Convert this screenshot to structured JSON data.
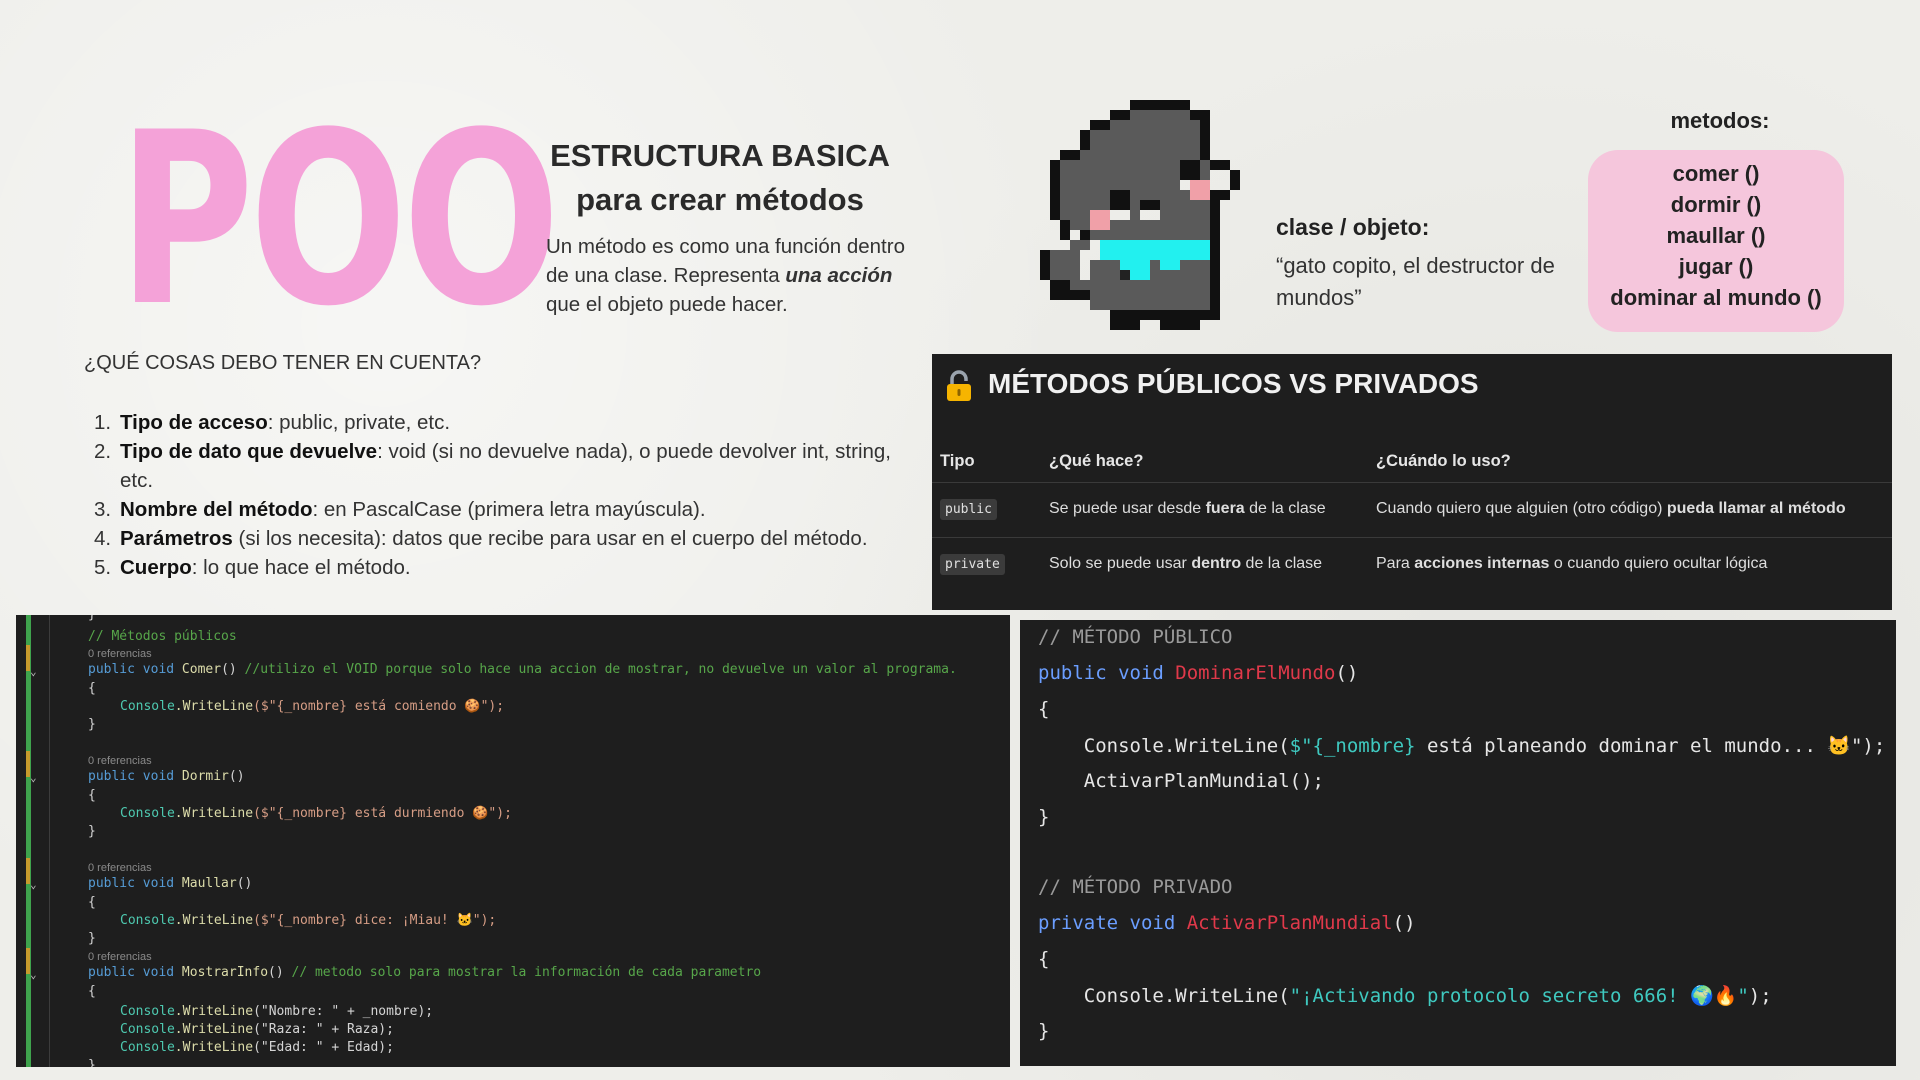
{
  "title": "POO",
  "heading": {
    "line1": "ESTRUCTURA BASICA",
    "line2": "para crear métodos"
  },
  "intro": {
    "before": "Un método es como una función dentro de una clase. Representa ",
    "emph": "una acción",
    "after": " que el objeto puede hacer."
  },
  "class_section": {
    "label": "clase / objeto:",
    "desc": "“gato copito, el destructor de mundos”"
  },
  "methods": {
    "title": "metodos:",
    "items": [
      "comer ()",
      "dormir ()",
      "maullar ()",
      "jugar ()",
      "dominar al mundo ()"
    ]
  },
  "question": "¿QUÉ COSAS DEBO TENER EN CUENTA?",
  "points": [
    {
      "num": "1.",
      "bold": "Tipo de acceso",
      "text": ": public, private, etc."
    },
    {
      "num": "2.",
      "bold": "Tipo de dato que devuelve",
      "text": ": void (si no devuelve nada), o puede devolver int, string, etc."
    },
    {
      "num": "3.",
      "bold": "Nombre del método",
      "text": ": en PascalCase (primera letra mayúscula)."
    },
    {
      "num": "4.",
      "bold": "Parámetros",
      "text": " (si los necesita): datos que recibe para usar en el cuerpo del método."
    },
    {
      "num": "5.",
      "bold": "Cuerpo",
      "text": ": lo que hace el método."
    }
  ],
  "table": {
    "title": "MÉTODOS PÚBLICOS VS PRIVADOS",
    "headers": [
      "Tipo",
      "¿Qué hace?",
      "¿Cuándo lo uso?"
    ],
    "rows": [
      {
        "tipo": "public",
        "que_a": "Se puede usar desde ",
        "que_b": "fuera",
        "que_c": " de la clase",
        "cuando_a": "Cuando quiero que alguien (otro código) ",
        "cuando_b": "pueda llamar al método",
        "cuando_c": ""
      },
      {
        "tipo": "private",
        "que_a": "Solo se puede usar ",
        "que_b": "dentro",
        "que_c": " de la clase",
        "cuando_a": "Para ",
        "cuando_b": "acciones internas",
        "cuando_c": " o cuando quiero ocultar lógica"
      }
    ]
  },
  "code_left": {
    "c_brace0": "}",
    "c_comment_pub": "// Métodos públicos",
    "refs": "0 referencias",
    "comer_sig_a": "public void ",
    "comer_sig_b": "Comer",
    "comer_sig_c": "() ",
    "comer_comment": "//utilizo el VOID porque solo hace una accion de mostrar, no devuelve un valor al programa.",
    "open": "{",
    "close": "}",
    "comer_body_a": "Console",
    "comer_body_b": ".WriteLine",
    "comer_body_c": "($\"{_nombre} está comiendo 🍪\");",
    "dormir_sig": "Dormir",
    "dormir_body_c": "($\"{_nombre} está durmiendo 🍪\");",
    "maullar_sig": "Maullar",
    "maullar_body_c": "($\"{_nombre} dice: ¡Miau! 🐱\");",
    "info_sig": "MostrarInfo",
    "info_comment": "// metodo solo para mostrar la información de cada parametro",
    "info_l1": "(\"Nombre: \" + _nombre);",
    "info_l2": "(\"Raza: \" + Raza);",
    "info_l3": "(\"Edad: \" + Edad);"
  },
  "code_right": {
    "c1": "// MÉTODO PÚBLICO",
    "pub_kw": "public void ",
    "pub_fn": "DominarElMundo",
    "parens": "()",
    "open": "{",
    "close": "}",
    "l1_a": "    Console.WriteLine(",
    "l1_b": "$\"{_nombre}",
    "l1_c": " está planeando dominar el mundo... 🐱",
    "l1_d": "\");",
    "l2": "    ActivarPlanMundial();",
    "c2": "// MÉTODO PRIVADO",
    "priv_kw": "private void ",
    "priv_fn": "ActivarPlanMundial",
    "l3_a": "    Console.WriteLine(",
    "l3_b": "\"¡Activando protocolo secreto 666! 🌍🔥\"",
    "l3_c": ");"
  },
  "colors": {
    "pink_title": "#f4a2d8",
    "pink_box": "#f5c6dc",
    "panel_bg": "#1e1e1e",
    "cat_body": "#5a5a5a",
    "cat_scarf": "#22f0ef"
  }
}
